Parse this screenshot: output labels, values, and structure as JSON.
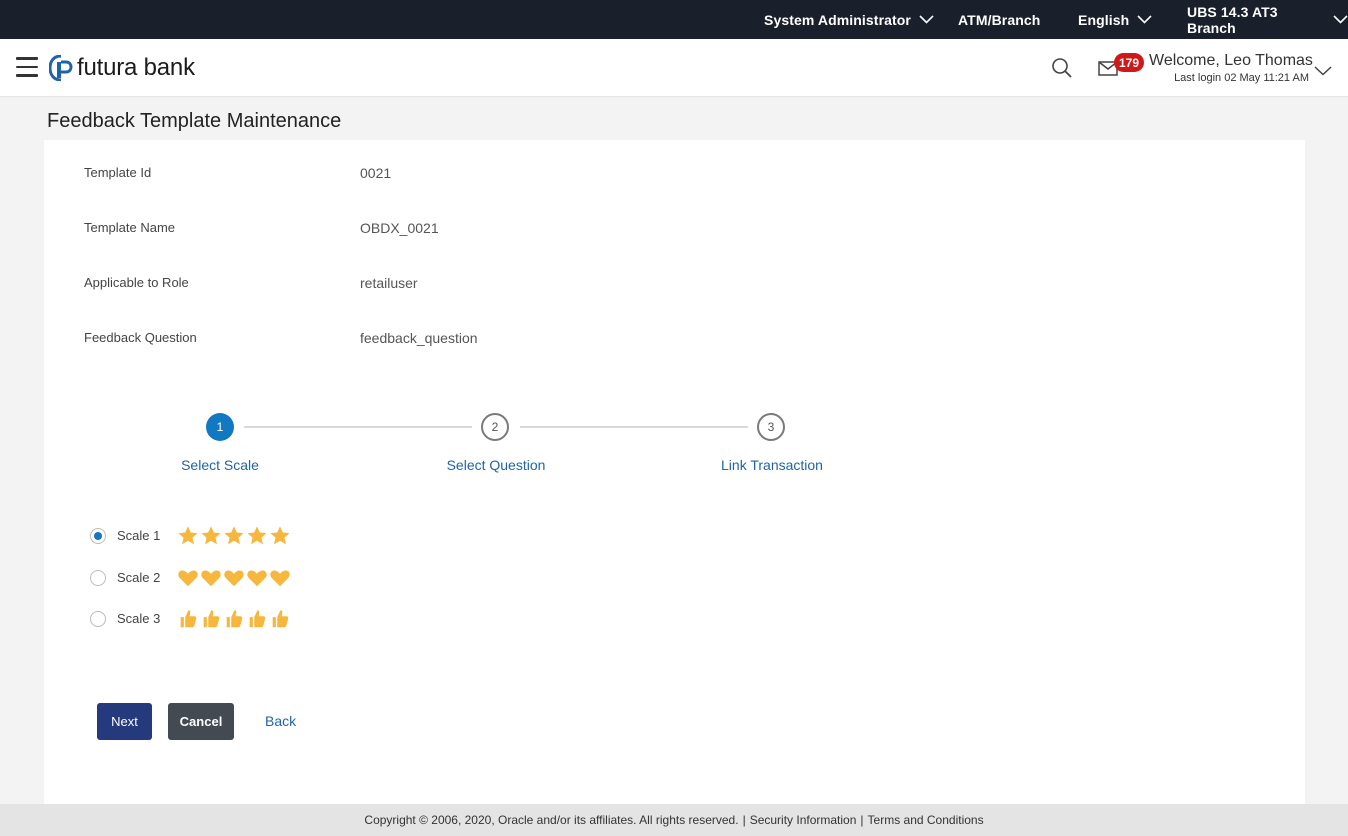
{
  "topbar": {
    "role": "System Administrator",
    "atm_branch": "ATM/Branch",
    "language": "English",
    "branch": "UBS 14.3 AT3 Branch"
  },
  "header": {
    "logo_text": "futura bank",
    "mail_count": "179",
    "welcome": "Welcome, Leo Thomas",
    "last_login": "Last login 02 May 11:21 AM"
  },
  "page": {
    "title": "Feedback Template Maintenance"
  },
  "fields": [
    {
      "label": "Template Id",
      "value": "0021"
    },
    {
      "label": "Template Name",
      "value": "OBDX_0021"
    },
    {
      "label": "Applicable to Role",
      "value": "retailuser"
    },
    {
      "label": "Feedback Question",
      "value": "feedback_question"
    }
  ],
  "stepper": {
    "steps": [
      {
        "number": "1",
        "label": "Select Scale",
        "state": "active"
      },
      {
        "number": "2",
        "label": "Select Question",
        "state": "inactive"
      },
      {
        "number": "3",
        "label": "Link Transaction",
        "state": "inactive"
      }
    ]
  },
  "scales": [
    {
      "label": "Scale 1",
      "icon": "star-icon",
      "count": 5,
      "selected": true
    },
    {
      "label": "Scale 2",
      "icon": "heart-icon",
      "count": 5,
      "selected": false
    },
    {
      "label": "Scale 3",
      "icon": "thumbs-up-icon",
      "count": 5,
      "selected": false
    }
  ],
  "actions": {
    "next": "Next",
    "cancel": "Cancel",
    "back": "Back"
  },
  "footer": {
    "copyright": "Copyright © 2006, 2020, Oracle and/or its affiliates. All rights reserved.",
    "separator": "|",
    "security": "Security Information",
    "terms": "Terms and Conditions"
  },
  "colors": {
    "topbar_bg": "#1a1f2c",
    "primary_button": "#253a7d",
    "secondary_button": "#444a52",
    "accent_blue": "#1378c2",
    "link_blue": "#1f64a8",
    "badge_red": "#d01818",
    "rating_icon": "#f6b73c"
  }
}
